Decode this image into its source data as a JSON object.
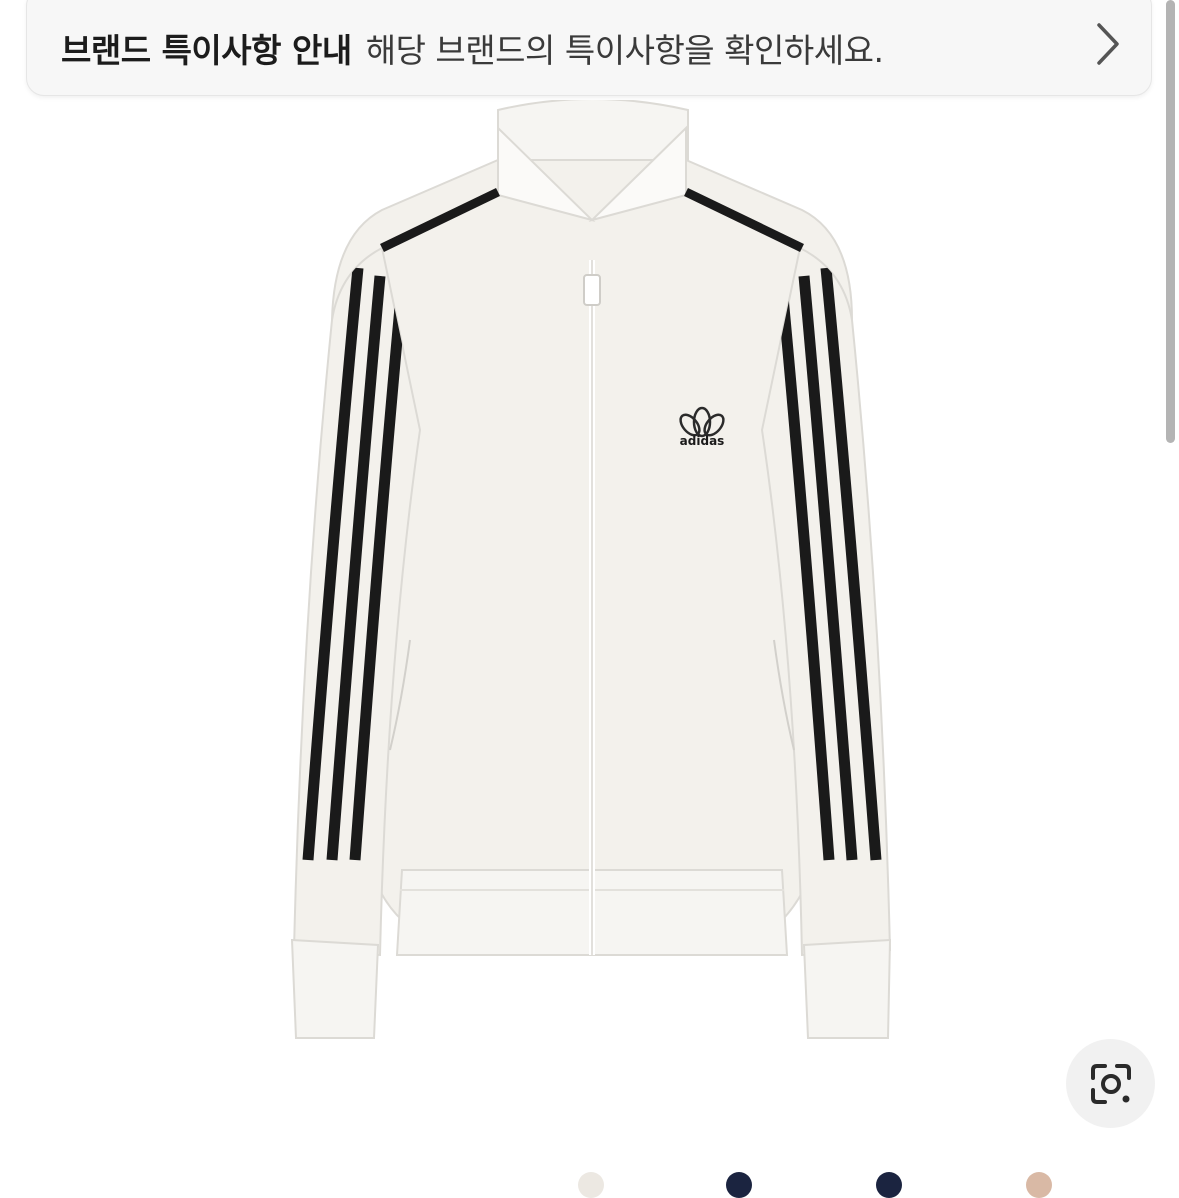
{
  "notice": {
    "title": "브랜드 특이사항 안내",
    "description": "해당 브랜드의 특이사항을 확인하세요."
  },
  "icons": {
    "notice_chevron": "chevron-right-icon",
    "lens": "visual-search-lens-icon",
    "brand_logo": "adidas-trefoil-logo"
  },
  "colors": {
    "banner_bg": "#f7f7f7",
    "jacket": "#f3f1ec",
    "stripes": "#1a1a1a",
    "swatches": [
      "#ece8e2",
      "#1b2440",
      "#1b2440",
      "#d9b9a5"
    ]
  },
  "logo_text": "adidas"
}
